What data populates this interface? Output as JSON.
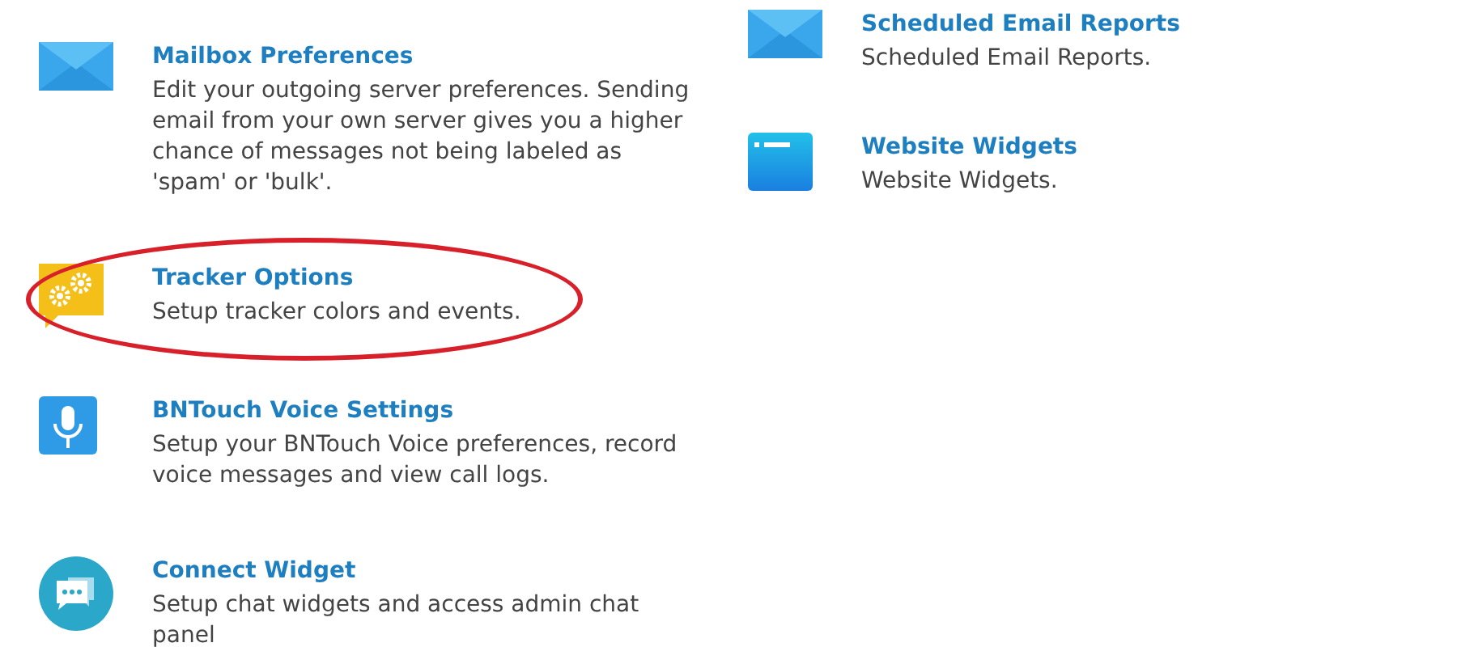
{
  "columns": [
    {
      "items": [
        {
          "kind": "envelope",
          "title": "Mailbox Preferences",
          "description": "Edit your outgoing server preferences. Sending email from your own server gives you a higher chance of messages not being labeled as 'spam' or 'bulk'.",
          "highlighted": false
        },
        {
          "kind": "gears",
          "title": "Tracker Options",
          "description": "Setup tracker colors and events.",
          "highlighted": true
        },
        {
          "kind": "microphone",
          "title": "BNTouch Voice Settings",
          "description": "Setup your BNTouch Voice preferences, record voice messages and view call logs.",
          "highlighted": false
        },
        {
          "kind": "chat",
          "title": "Connect Widget",
          "description": "Setup chat widgets and access admin chat panel",
          "highlighted": false
        }
      ]
    },
    {
      "items": [
        {
          "kind": "envelope",
          "title": "Scheduled Email Reports",
          "description": "Scheduled Email Reports.",
          "highlighted": false
        },
        {
          "kind": "browser",
          "title": "Website Widgets",
          "description": "Website Widgets.",
          "highlighted": false
        }
      ]
    }
  ]
}
